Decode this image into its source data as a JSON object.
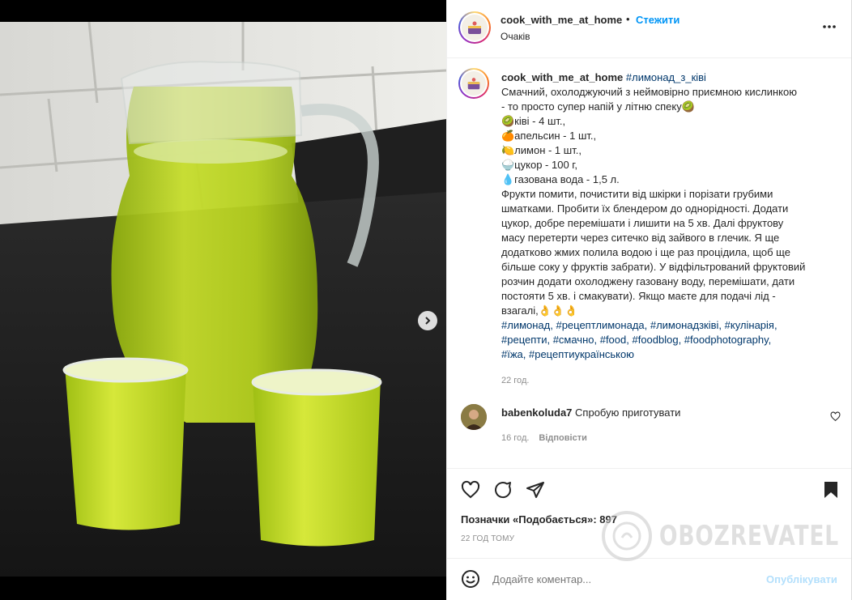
{
  "header": {
    "username": "cook_with_me_at_home",
    "separator": "•",
    "follow_label": "Стежити",
    "subtitle": "Очаків",
    "more_icon": "more-horizontal-icon"
  },
  "caption": {
    "username": "cook_with_me_at_home",
    "title_tag": "#лимонад_з_ківі",
    "lines": [
      "Смачний, охолоджуючий з неймовірно приємною кислинкою",
      "- то просто супер напій у літню спеку🥝",
      "🥝ківі - 4 шт.,",
      "🍊апельсин - 1 шт.,",
      "🍋лимон - 1 шт.,",
      "🍚цукор - 100 г,",
      "💧газована вода - 1,5 л.",
      "Фрукти помити, почистити від шкірки і порізати грубими",
      "шматками. Пробити їх блендером до однорідності. Додати",
      "цукор, добре перемішати і лишити на 5 хв. Далі фруктову",
      "масу перетерти через ситечко від зайвого в глечик. Я ще",
      "додатково жмих полила водою і ще раз процідила, щоб ще",
      "більше соку у фруктів забрати). У відфільтрований фруктовий",
      "розчин додати охолоджену газовану воду, перемішати, дати",
      "постояти 5 хв. і смакувати). Якщо маєте для подачі лід -",
      "взагалі,👌👌👌"
    ],
    "hashtag_lines": [
      "#лимонад, #рецептлимонада, #лимонадзківі, #кулінарія,",
      "#рецепти, #смачно, #food, #foodblog, #foodphotography,",
      "#їжа, #рецептиукраїнською"
    ],
    "time": "22 год."
  },
  "comment": {
    "username": "babenkoluda7",
    "text": "Спробую приготувати",
    "time": "16 год.",
    "reply_label": "Відповісти"
  },
  "actions": {
    "likes_text": "Позначки «Подобається»: 897",
    "posted": "22 ГОД ТОМУ"
  },
  "add_comment": {
    "placeholder": "Додайте коментар...",
    "publish_label": "Опублікувати"
  },
  "carousel": {
    "total": 8,
    "active_index": 0
  },
  "watermark": {
    "text": "OBOZREVATEL"
  },
  "colors": {
    "link": "#0095f6",
    "hashtag": "#00376b",
    "muted": "#8e8e8e",
    "juice": "#b5d21f"
  }
}
